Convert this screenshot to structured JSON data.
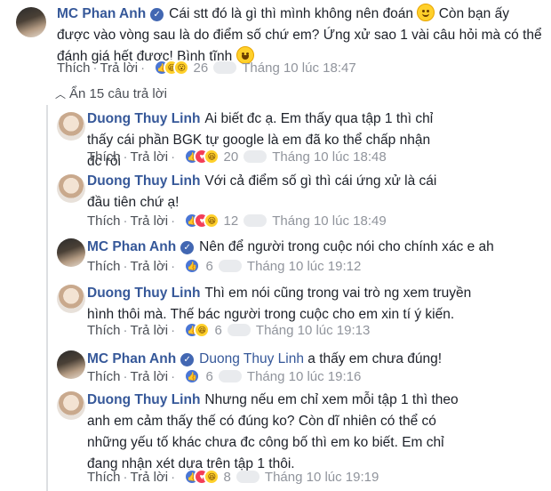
{
  "hide_replies": "Ẩn 15 câu trả lời",
  "actions": {
    "like": "Thích",
    "reply": "Trả lời",
    "separator": "·"
  },
  "comments": [
    {
      "author": "MC Phan Anh",
      "verified": true,
      "text1": "Cái stt đó là gì thì mình không nên đoán",
      "text2": "Còn bạn ấy",
      "line2": "được vào vòng sau là do điểm số chứ em? Ứng xử sao 1 vài câu hỏi mà có thể",
      "line3": "đánh giá hết được! Bình tĩnh",
      "reaction_count": "26",
      "time": "Tháng 10 lúc 18:47",
      "reactions": [
        "like-icon",
        "haha-icon",
        "wow-icon"
      ]
    },
    {
      "author": "Duong Thuy Linh",
      "text": "Ai biết đc ạ. Em thấy qua tập 1 thì chỉ thấy cái phần BGK tự google là em đã ko thể chấp nhận đc rồi",
      "reaction_count": "20",
      "time": "Tháng 10 lúc 18:48",
      "reactions": [
        "like-icon",
        "love-icon",
        "haha-icon"
      ]
    },
    {
      "author": "Duong Thuy Linh",
      "text": "Với cả điểm số gì thì cái ứng xử là cái đầu tiên chứ ạ!",
      "reaction_count": "12",
      "time": "Tháng 10 lúc 18:49",
      "reactions": [
        "like-icon",
        "love-icon",
        "haha-icon"
      ]
    },
    {
      "author": "MC Phan Anh",
      "verified": true,
      "text": "Nên để người trong cuộc nói cho chính xác e ah",
      "reaction_count": "6",
      "time": "Tháng 10 lúc 19:12",
      "reactions": [
        "like-icon"
      ]
    },
    {
      "author": "Duong Thuy Linh",
      "text": "Thì em nói cũng trong vai trò ng xem truyền hình thôi mà. Thế bác người trong cuộc cho em xin tí ý kiến.",
      "reaction_count": "6",
      "time": "Tháng 10 lúc 19:13",
      "reactions": [
        "like-icon",
        "haha-icon"
      ]
    },
    {
      "author": "MC Phan Anh",
      "verified": true,
      "mention": "Duong Thuy Linh",
      "text": "a thấy em chưa đúng!",
      "reaction_count": "6",
      "time": "Tháng 10 lúc 19:16",
      "reactions": [
        "like-icon"
      ]
    },
    {
      "author": "Duong Thuy Linh",
      "text": "Nhưng nếu em chỉ xem mỗi tập 1 thì theo anh em cảm thấy thế có đúng ko? Còn dĩ nhiên có thể có những yếu tố khác chưa đc công bố thì em ko biết. Em chỉ đang nhận xét dựa trên tập 1 thôi.",
      "reaction_count": "8",
      "time": "Tháng 10 lúc 19:19",
      "reactions": [
        "like-icon",
        "love-icon",
        "haha-icon"
      ]
    }
  ]
}
